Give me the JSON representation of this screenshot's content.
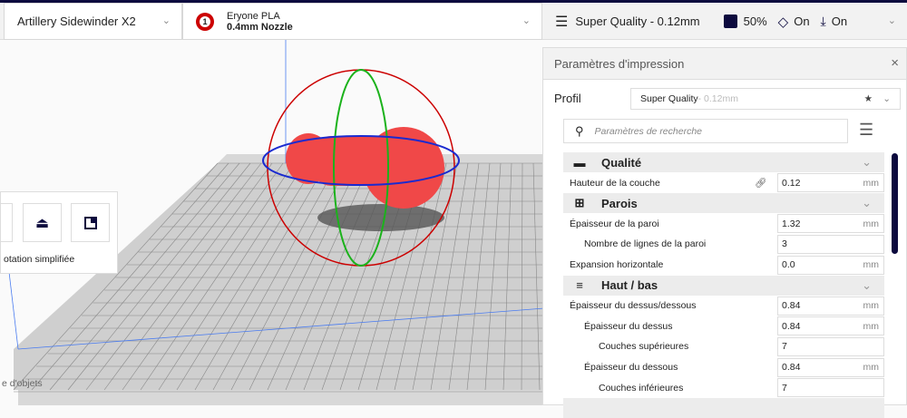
{
  "machine": {
    "name": "Artillery Sidewinder X2"
  },
  "material": {
    "badge": "1",
    "name": "Eryone PLA",
    "nozzle": "0.4mm Nozzle"
  },
  "print_setup": {
    "profile": "Super Quality - 0.12mm",
    "infill": "50%",
    "support": "On",
    "adhesion": "On"
  },
  "tool_panel": {
    "label": "otation simplifiée"
  },
  "bottom_left": {
    "objects": "e d'objets"
  },
  "panel": {
    "title": "Paramètres d'impression",
    "close": "×",
    "profile_label": "Profil",
    "profile_name": "Super Quality",
    "profile_sub": " - 0.12mm",
    "search_placeholder": "Paramètres de recherche"
  },
  "settings": [
    {
      "type": "section",
      "label": "Qualité"
    },
    {
      "type": "setting",
      "label": "Hauteur de la couche",
      "value": "0.12",
      "unit": "mm",
      "indent": 0,
      "link": true
    },
    {
      "type": "section",
      "label": "Parois"
    },
    {
      "type": "setting",
      "label": "Épaisseur de la paroi",
      "value": "1.32",
      "unit": "mm",
      "indent": 0
    },
    {
      "type": "setting",
      "label": "Nombre de lignes de la paroi",
      "value": "3",
      "unit": "",
      "indent": 1
    },
    {
      "type": "setting",
      "label": "Expansion horizontale",
      "value": "0.0",
      "unit": "mm",
      "indent": 0
    },
    {
      "type": "section",
      "label": "Haut / bas"
    },
    {
      "type": "setting",
      "label": "Épaisseur du dessus/dessous",
      "value": "0.84",
      "unit": "mm",
      "indent": 0
    },
    {
      "type": "setting",
      "label": "Épaisseur du dessus",
      "value": "0.84",
      "unit": "mm",
      "indent": 1
    },
    {
      "type": "setting",
      "label": "Couches supérieures",
      "value": "7",
      "unit": "",
      "indent": 2
    },
    {
      "type": "setting",
      "label": "Épaisseur du dessous",
      "value": "0.84",
      "unit": "mm",
      "indent": 1
    },
    {
      "type": "setting",
      "label": "Couches inférieures",
      "value": "7",
      "unit": "",
      "indent": 2
    }
  ],
  "colors": {
    "accent": "#0c0a3e",
    "model": "#f04848"
  }
}
